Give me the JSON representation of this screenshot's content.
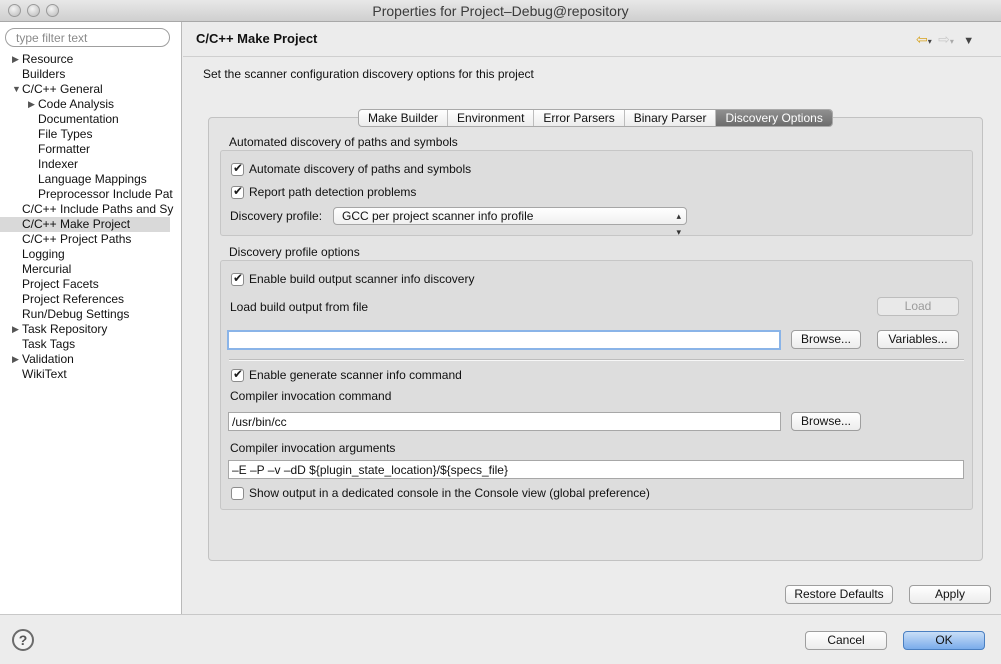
{
  "window": {
    "title": "Properties for Project–Debug@repository"
  },
  "sidebar": {
    "filter_placeholder": "type filter text",
    "items": [
      {
        "label": "Resource",
        "indent": 0,
        "expander": "collapsed"
      },
      {
        "label": "Builders",
        "indent": 0,
        "expander": "none"
      },
      {
        "label": "C/C++ General",
        "indent": 0,
        "expander": "expanded"
      },
      {
        "label": "Code Analysis",
        "indent": 1,
        "expander": "collapsed"
      },
      {
        "label": "Documentation",
        "indent": 2,
        "expander": "none"
      },
      {
        "label": "File Types",
        "indent": 2,
        "expander": "none"
      },
      {
        "label": "Formatter",
        "indent": 2,
        "expander": "none"
      },
      {
        "label": "Indexer",
        "indent": 2,
        "expander": "none"
      },
      {
        "label": "Language Mappings",
        "indent": 2,
        "expander": "none"
      },
      {
        "label": "Preprocessor Include Pat",
        "indent": 2,
        "expander": "none"
      },
      {
        "label": "C/C++ Include Paths and Sy",
        "indent": 1,
        "expander": "none"
      },
      {
        "label": "C/C++ Make Project",
        "indent": 1,
        "expander": "none",
        "selected": true
      },
      {
        "label": "C/C++ Project Paths",
        "indent": 1,
        "expander": "none"
      },
      {
        "label": "Logging",
        "indent": 1,
        "expander": "none"
      },
      {
        "label": "Mercurial",
        "indent": 1,
        "expander": "none"
      },
      {
        "label": "Project Facets",
        "indent": 1,
        "expander": "none"
      },
      {
        "label": "Project References",
        "indent": 1,
        "expander": "none"
      },
      {
        "label": "Run/Debug Settings",
        "indent": 1,
        "expander": "none"
      },
      {
        "label": "Task Repository",
        "indent": 0,
        "expander": "collapsed"
      },
      {
        "label": "Task Tags",
        "indent": 1,
        "expander": "none"
      },
      {
        "label": "Validation",
        "indent": 0,
        "expander": "collapsed"
      },
      {
        "label": "WikiText",
        "indent": 1,
        "expander": "none"
      }
    ]
  },
  "header": {
    "title": "C/C++ Make Project",
    "description": "Set the scanner configuration discovery options for this project"
  },
  "tabs": [
    {
      "label": "Make Builder",
      "active": false
    },
    {
      "label": "Environment",
      "active": false
    },
    {
      "label": "Error Parsers",
      "active": false
    },
    {
      "label": "Binary Parser",
      "active": false
    },
    {
      "label": "Discovery Options",
      "active": true
    }
  ],
  "auto_group": {
    "label": "Automated discovery of paths and symbols",
    "automate_label": "Automate discovery of paths and symbols",
    "automate_checked": true,
    "report_label": "Report path detection problems",
    "report_checked": true,
    "profile_label": "Discovery profile:",
    "profile_value": "GCC per project scanner info profile"
  },
  "profile_group": {
    "label": "Discovery profile options",
    "enable_build_label": "Enable build output scanner info discovery",
    "enable_build_checked": true,
    "load_label": "Load build output from file",
    "load_button": "Load",
    "load_file_value": "",
    "browse_label": "Browse...",
    "variables_label": "Variables...",
    "enable_generate_label": "Enable generate scanner info command",
    "enable_generate_checked": true,
    "compiler_cmd_label": "Compiler invocation command",
    "compiler_cmd_value": "/usr/bin/cc",
    "browse2_label": "Browse...",
    "compiler_args_label": "Compiler invocation arguments",
    "compiler_args_value": "–E –P –v –dD ${plugin_state_location}/${specs_file}",
    "show_output_label": "Show output in a dedicated console in the Console view (global preference)",
    "show_output_checked": false
  },
  "actions": {
    "restore_defaults": "Restore Defaults",
    "apply": "Apply",
    "cancel": "Cancel",
    "ok": "OK",
    "help_glyph": "?"
  },
  "colors": {
    "selection": "#d9d9d9",
    "active_tab": "#7a7a7a",
    "ok_button": "#7aaceb"
  }
}
